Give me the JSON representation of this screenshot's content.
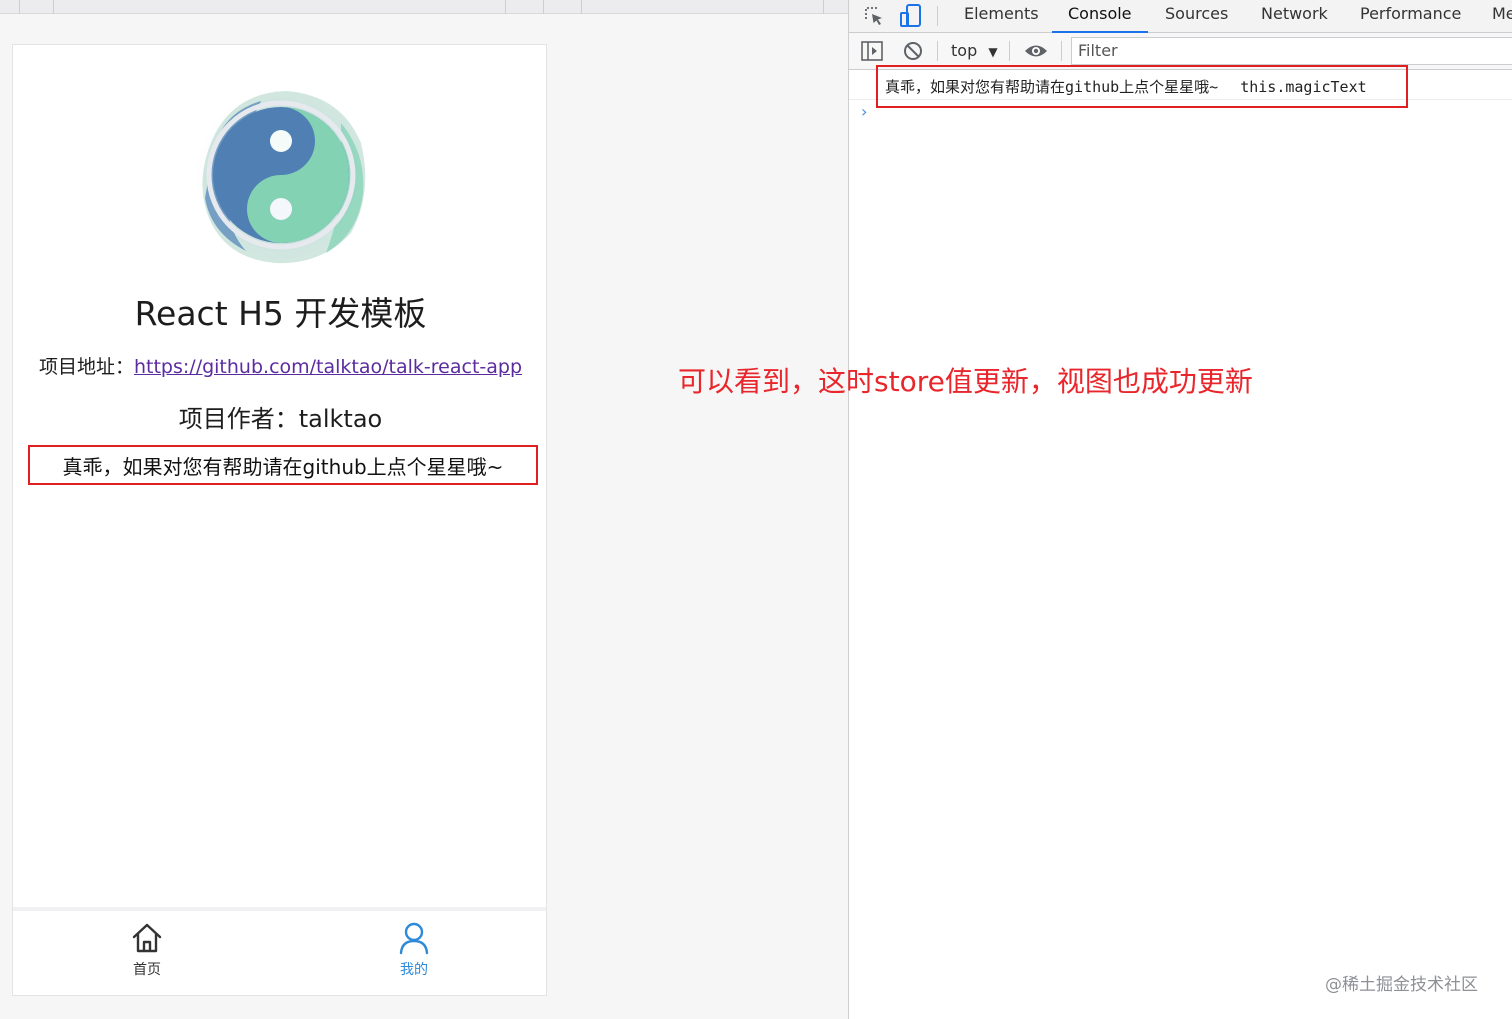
{
  "preview": {
    "app_title": "React H5 开发模板",
    "address_label": "项目地址：",
    "address_link": "https://github.com/talktao/talk-react-app",
    "author": "项目作者：talktao",
    "magic_text": "真乖，如果对您有帮助请在github上点个星星哦~",
    "tabs": [
      {
        "label": "首页",
        "icon": "home-icon",
        "active": false
      },
      {
        "label": "我的",
        "icon": "user-icon",
        "active": true
      }
    ]
  },
  "annotation": "可以看到，这时store值更新，视图也成功更新",
  "devtools": {
    "tabs": [
      "Elements",
      "Console",
      "Sources",
      "Network",
      "Performance",
      "Me"
    ],
    "active_tab": "Console",
    "context": "top",
    "filter_placeholder": "Filter",
    "log": {
      "message": "真乖，如果对您有帮助请在github上点个星星哦~",
      "expression": "this.magicText"
    },
    "prompt": "›"
  },
  "watermark": "@稀土掘金技术社区",
  "colors": {
    "highlight": "#e02020",
    "annotation": "#e8262b",
    "active_tab": "#1a73e8",
    "link": "#5a2ca0",
    "tab_active": "#2e8ad8"
  }
}
